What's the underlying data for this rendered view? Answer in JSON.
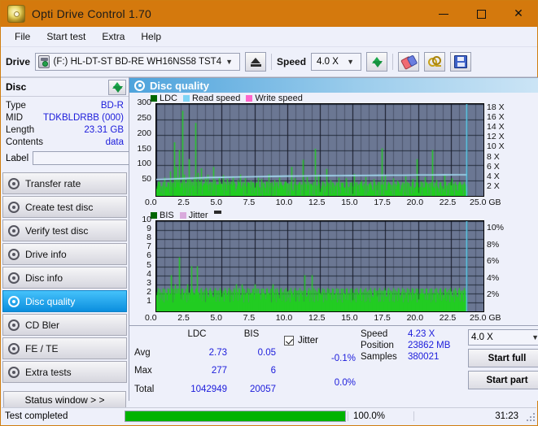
{
  "window": {
    "title": "Opti Drive Control 1.70",
    "app_icon": "disc-icon",
    "minimize": "—",
    "maximize": "□",
    "close": "✕",
    "titlebar_color": "#d4790d"
  },
  "menu": {
    "items": [
      "File",
      "Start test",
      "Extra",
      "Help"
    ]
  },
  "toolbar": {
    "drive_label": "Drive",
    "drive_value": "(F:)  HL-DT-ST BD-RE  WH16NS58 TST4",
    "eject_icon": "eject-icon",
    "speed_label": "Speed",
    "speed_value": "4.0 X",
    "refresh_icon": "refresh-icon",
    "eraser_icon": "eraser-icon",
    "keys_icon": "keys-icon",
    "save_icon": "floppy-save-icon"
  },
  "disc": {
    "header": "Disc",
    "refresh_icon": "refresh-icon",
    "rows": [
      {
        "key": "Type",
        "value": "BD-R"
      },
      {
        "key": "MID",
        "value": "TDKBLDRBB (000)"
      },
      {
        "key": "Length",
        "value": "23.31 GB"
      },
      {
        "key": "Contents",
        "value": "data"
      }
    ],
    "label_key": "Label",
    "label_value": "",
    "label_placeholder": "",
    "disc_button_icon": "disc-icon"
  },
  "sidebar": {
    "items": [
      {
        "label": "Transfer rate",
        "selected": false
      },
      {
        "label": "Create test disc",
        "selected": false
      },
      {
        "label": "Verify test disc",
        "selected": false
      },
      {
        "label": "Drive info",
        "selected": false
      },
      {
        "label": "Disc info",
        "selected": false
      },
      {
        "label": "Disc quality",
        "selected": true
      },
      {
        "label": "CD Bler",
        "selected": false
      },
      {
        "label": "FE / TE",
        "selected": false
      },
      {
        "label": "Extra tests",
        "selected": false
      }
    ],
    "status_window": "Status window > >"
  },
  "panel": {
    "title": "Disc quality",
    "icon": "disc-quality-icon"
  },
  "chart_data": [
    {
      "type": "line",
      "name": "top-chart",
      "title": "Disc quality - LDC",
      "xlabel": "GB",
      "ylabel": "",
      "xlim": [
        0,
        25
      ],
      "ylim": [
        0,
        300
      ],
      "xticks": [
        "0.0",
        "2.5",
        "5.0",
        "7.5",
        "10.0",
        "12.5",
        "15.0",
        "17.5",
        "20.0",
        "22.5",
        "25.0 GB"
      ],
      "yticks": [
        "50",
        "100",
        "150",
        "200",
        "250",
        "300"
      ],
      "y2lim": [
        0,
        19
      ],
      "y2ticks": [
        "2 X",
        "4 X",
        "6 X",
        "8 X",
        "10 X",
        "12 X",
        "14 X",
        "16 X",
        "18 X"
      ],
      "grid": true,
      "legend": [
        {
          "label": "LDC",
          "color": "#006600"
        },
        {
          "label": "Read speed",
          "color": "#7fd4f5"
        },
        {
          "label": "Write speed",
          "color": "#ff66cc"
        }
      ],
      "series": [
        {
          "name": "LDC",
          "color": "#22cc22",
          "kind": "impulse",
          "x": [
            0.05,
            0.2,
            0.35,
            0.5,
            0.62,
            0.78,
            0.9,
            1.05,
            1.2,
            1.35,
            1.5,
            1.62,
            1.75,
            1.88,
            2.0,
            2.12,
            2.25,
            2.35,
            2.48,
            2.6,
            2.72,
            2.85,
            3.0,
            3.15,
            3.3,
            3.45,
            3.6,
            3.75,
            3.9,
            4.05,
            4.2,
            4.35,
            4.5,
            4.65,
            4.8,
            4.95,
            5.1,
            5.25,
            5.4,
            5.55,
            5.7,
            5.85,
            6.0,
            6.2,
            6.4,
            6.6,
            6.8,
            7.0,
            7.2,
            7.4,
            7.6,
            7.8,
            8.0,
            8.2,
            8.4,
            8.6,
            8.8,
            9.0,
            9.2,
            9.4,
            9.6,
            9.8,
            10.0,
            10.3,
            10.6,
            10.9,
            11.2,
            11.5,
            11.8,
            12.1,
            12.4,
            12.7,
            13.0,
            13.3,
            13.6,
            13.9,
            14.2,
            14.5,
            14.8,
            15.1,
            15.4,
            15.7,
            16.0,
            16.3,
            16.6,
            16.9,
            17.2,
            17.5,
            17.8,
            18.1,
            18.4,
            18.7,
            19.0,
            19.3,
            19.6,
            19.9,
            20.2,
            20.5,
            20.8,
            21.1,
            21.4,
            21.7,
            22.0,
            22.3,
            22.6,
            22.9,
            23.2,
            23.5,
            23.7
          ],
          "values": [
            30,
            48,
            22,
            35,
            60,
            28,
            45,
            80,
            40,
            175,
            95,
            60,
            150,
            42,
            278,
            70,
            38,
            55,
            120,
            52,
            35,
            62,
            238,
            75,
            48,
            90,
            42,
            58,
            70,
            36,
            44,
            95,
            52,
            38,
            60,
            40,
            68,
            42,
            56,
            35,
            48,
            62,
            40,
            52,
            70,
            38,
            58,
            44,
            50,
            36,
            42,
            60,
            55,
            40,
            48,
            70,
            38,
            52,
            44,
            60,
            36,
            48,
            42,
            95,
            58,
            44,
            118,
            62,
            40,
            154,
            70,
            48,
            88,
            52,
            36,
            60,
            42,
            58,
            44,
            72,
            38,
            50,
            62,
            40,
            55,
            46,
            155,
            68,
            42,
            58,
            50,
            36,
            64,
            42,
            56,
            120,
            48,
            62,
            40,
            150,
            52,
            44,
            68,
            42,
            58,
            36,
            46,
            40,
            30
          ]
        },
        {
          "name": "Read speed",
          "color": "#a8e1f8",
          "kind": "line",
          "x": [
            0.0,
            1.0,
            2.0,
            3.0,
            4.0,
            5.0,
            6.0,
            7.0,
            8.0,
            9.0,
            10.0,
            11.0,
            12.0,
            13.0,
            14.0,
            15.0,
            16.0,
            17.0,
            18.0,
            19.0,
            20.0,
            21.0,
            22.0,
            23.0,
            23.7
          ],
          "values_x": [
            3.4,
            3.5,
            3.6,
            3.7,
            3.8,
            3.85,
            3.9,
            3.95,
            4.0,
            4.05,
            4.1,
            4.12,
            4.15,
            4.18,
            4.2,
            4.22,
            4.24,
            4.26,
            4.28,
            4.3,
            4.32,
            4.34,
            4.35,
            4.36,
            4.36
          ]
        }
      ],
      "marker_line_x": 23.72,
      "marker_line_color": "#5ad0ef"
    },
    {
      "type": "line",
      "name": "bottom-chart",
      "title": "Disc quality - BIS",
      "xlabel": "GB",
      "xlim": [
        0,
        25
      ],
      "ylim": [
        0,
        10
      ],
      "xticks": [
        "0.0",
        "2.5",
        "5.0",
        "7.5",
        "10.0",
        "12.5",
        "15.0",
        "17.5",
        "20.0",
        "22.5",
        "25.0 GB"
      ],
      "yticks": [
        "1",
        "2",
        "3",
        "4",
        "5",
        "6",
        "7",
        "8",
        "9",
        "10"
      ],
      "y2lim": [
        0,
        11
      ],
      "y2ticks": [
        "2%",
        "4%",
        "6%",
        "8%",
        "10%"
      ],
      "grid": true,
      "legend": [
        {
          "label": "BIS",
          "color": "#006600"
        },
        {
          "label": "Jitter",
          "color": "#d9aadd"
        }
      ],
      "series": [
        {
          "name": "BIS",
          "color": "#22cc22",
          "kind": "impulse",
          "baseline": 1,
          "x": [
            0.1,
            0.25,
            0.4,
            0.55,
            0.7,
            0.85,
            1.0,
            1.15,
            1.3,
            1.45,
            1.6,
            1.75,
            1.9,
            2.05,
            2.2,
            2.35,
            2.5,
            2.65,
            2.8,
            2.95,
            3.1,
            3.25,
            3.4,
            3.55,
            3.7,
            3.85,
            4.0,
            4.15,
            4.3,
            4.45,
            4.6,
            4.75,
            4.9,
            5.05,
            5.2,
            5.35,
            5.5,
            5.65,
            5.8,
            5.95,
            6.1,
            6.3,
            6.5,
            6.7,
            6.9,
            7.1,
            7.3,
            7.5,
            7.7,
            7.9,
            8.1,
            8.3,
            8.5,
            8.7,
            8.9,
            9.1,
            9.3,
            9.5,
            9.7,
            9.9,
            10.1,
            10.4,
            10.7,
            11.0,
            11.3,
            11.6,
            11.9,
            12.2,
            12.5,
            12.8,
            13.1,
            13.4,
            13.7,
            14.0,
            14.3,
            14.6,
            14.9,
            15.2,
            15.5,
            15.8,
            16.1,
            16.4,
            16.7,
            17.0,
            17.3,
            17.6,
            17.9,
            18.2,
            18.5,
            18.8,
            19.1,
            19.4,
            19.7,
            20.0,
            20.3,
            20.6,
            20.9,
            21.2,
            21.5,
            21.8,
            22.1,
            22.4,
            22.7,
            23.0,
            23.3,
            23.6
          ],
          "values": [
            2,
            1,
            2,
            1,
            2,
            1,
            2,
            4,
            2,
            3,
            2,
            6,
            2,
            1,
            2,
            3,
            2,
            5,
            1,
            2,
            5,
            2,
            1,
            2,
            1,
            2,
            1,
            2,
            1,
            2,
            1,
            2,
            1,
            2,
            1,
            2,
            1,
            2,
            1,
            2,
            3,
            2,
            3,
            1,
            2,
            1,
            2,
            3,
            2,
            1,
            2,
            1,
            2,
            1,
            3,
            2,
            1,
            2,
            1,
            2,
            1,
            2,
            1,
            2,
            4,
            2,
            4,
            1,
            2,
            1,
            2,
            1,
            2,
            1,
            2,
            1,
            2,
            1,
            2,
            1,
            2,
            1,
            2,
            1,
            2,
            1,
            2,
            1,
            2,
            1,
            2,
            1,
            2,
            1,
            2,
            1,
            2,
            1,
            2,
            1,
            2,
            1,
            2,
            1,
            2,
            1
          ]
        }
      ],
      "marker_line_x": 23.72,
      "marker_line_color": "#5ad0ef"
    }
  ],
  "stats": {
    "col_headers": [
      "LDC",
      "BIS"
    ],
    "rows": [
      {
        "key": "Avg",
        "ldc": "2.73",
        "bis": "0.05"
      },
      {
        "key": "Max",
        "ldc": "277",
        "bis": "6"
      },
      {
        "key": "Total",
        "ldc": "1042949",
        "bis": "20057"
      }
    ],
    "jitter": {
      "checked": true,
      "label": "Jitter",
      "avg": "-0.1%",
      "max": "0.0%"
    },
    "info": [
      {
        "key": "Speed",
        "value": "4.23 X"
      },
      {
        "key": "Position",
        "value": "23862 MB"
      },
      {
        "key": "Samples",
        "value": "380021"
      }
    ],
    "speed_select": "4.0 X",
    "start_full": "Start full",
    "start_part": "Start part"
  },
  "statusbar": {
    "text": "Test completed",
    "progress": 100,
    "percent": "100.0%",
    "time": "31:23",
    "progress_color": "#00b300"
  }
}
